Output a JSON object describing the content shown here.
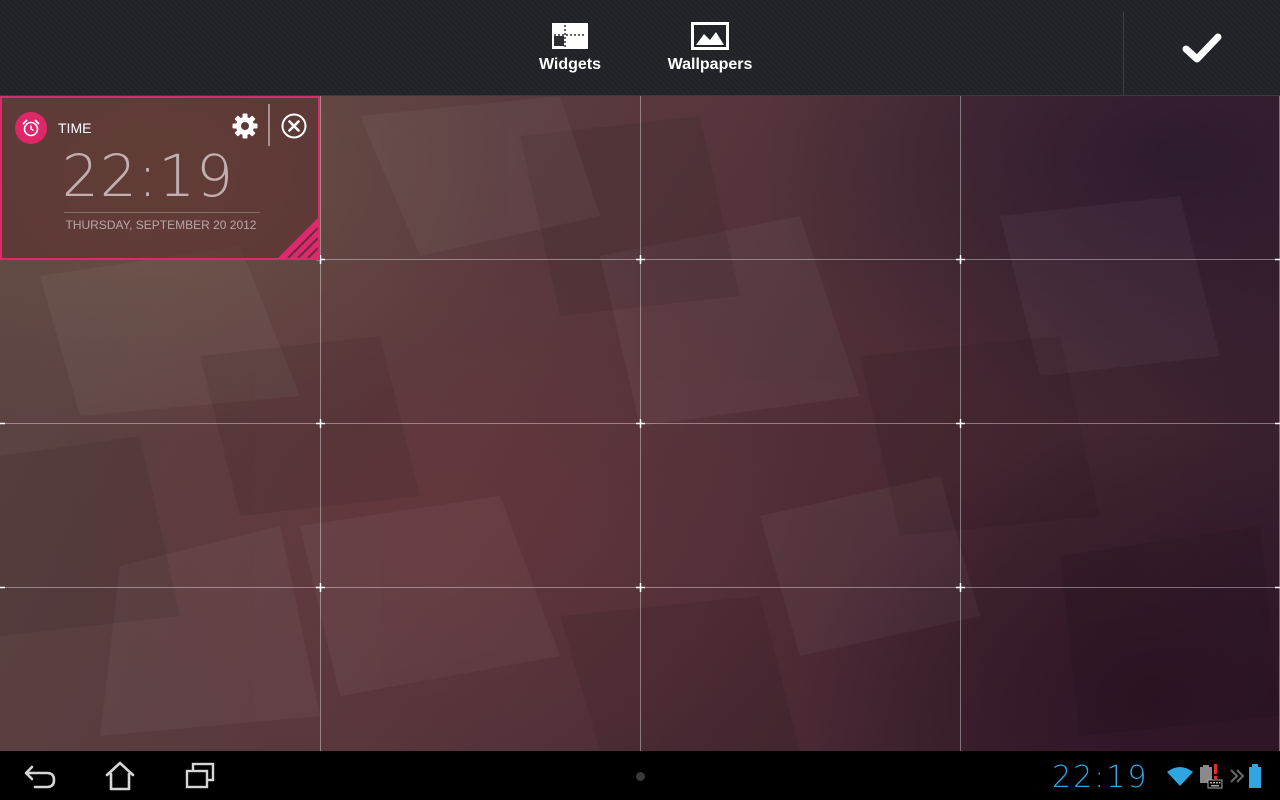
{
  "topbar": {
    "widgets_label": "Widgets",
    "wallpapers_label": "Wallpapers",
    "widgets_icon": "widgets-icon",
    "wallpapers_icon": "wallpaper-icon",
    "done_icon": "checkmark-icon"
  },
  "widget": {
    "label": "TIME",
    "time": "22:19",
    "date": "THURSDAY, SEPTEMBER 20 2012",
    "accent": "#e0286e",
    "icons": [
      "alarm-clock-icon",
      "gear-icon",
      "close-icon",
      "resize-handle-icon"
    ]
  },
  "workspace": {
    "grid_columns": 4,
    "grid_rows": 4
  },
  "statusbar": {
    "time": "22:19",
    "time_color": "#2fa6e2",
    "icons": [
      "back-icon",
      "home-icon",
      "recent-apps-icon",
      "wifi-icon",
      "keyboard-battery-icon",
      "usb-icon",
      "battery-icon"
    ]
  }
}
